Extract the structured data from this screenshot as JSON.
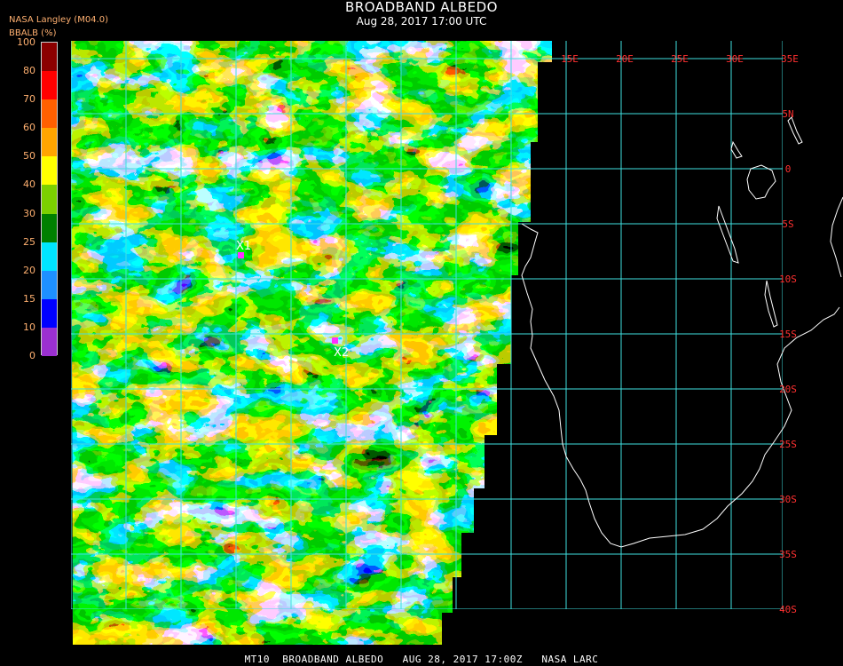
{
  "header": {
    "title": "BROADBAND ALBEDO",
    "subtitle": "Aug 28, 2017 17:00 UTC",
    "agency": "NASA Langley (M04.0)",
    "units": "BBALB (%)"
  },
  "legend": {
    "ticks": [
      "100",
      "80",
      "70",
      "60",
      "50",
      "40",
      "30",
      "25",
      "20",
      "15",
      "10",
      "0"
    ],
    "colors": [
      "#8b0000",
      "#ff0000",
      "#ff6000",
      "#ffa500",
      "#ffff00",
      "#7cd000",
      "#008000",
      "#00e5ff",
      "#1e90ff",
      "#0000ff",
      "#9b30d0"
    ]
  },
  "grid": {
    "lon_labels": [
      "15E",
      "20E",
      "25E",
      "30E",
      "35E"
    ],
    "lat_labels": [
      "5N",
      "0",
      "5S",
      "10S",
      "15S",
      "20S",
      "25S",
      "30S",
      "35S",
      "40S"
    ]
  },
  "markers": [
    {
      "label": "X1",
      "color": "#ff30ff"
    },
    {
      "label": "X2",
      "color": "#ff30ff"
    }
  ],
  "footer": "MT10  BROADBAND ALBEDO   AUG 28, 2017 17:00Z   NASA LARC"
}
